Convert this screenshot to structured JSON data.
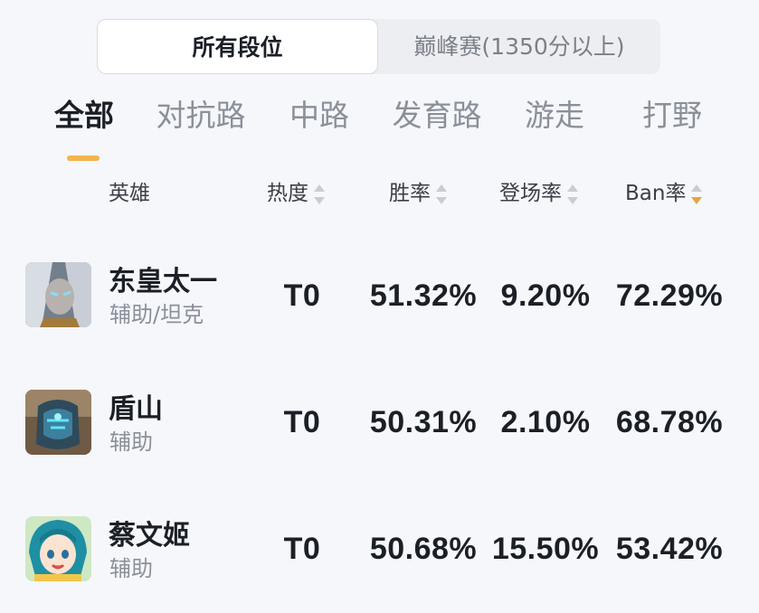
{
  "rank_toggle": {
    "options": [
      {
        "label": "所有段位",
        "active": true
      },
      {
        "label": "巅峰赛(1350分以上)",
        "active": false
      }
    ]
  },
  "role_tabs": {
    "items": [
      {
        "label": "全部",
        "active": true
      },
      {
        "label": "对抗路",
        "active": false
      },
      {
        "label": "中路",
        "active": false
      },
      {
        "label": "发育路",
        "active": false
      },
      {
        "label": "游走",
        "active": false
      },
      {
        "label": "打野",
        "active": false
      }
    ],
    "indicator_color": "#f2b54c"
  },
  "table": {
    "headers": {
      "hero": "英雄",
      "heat": "热度",
      "win_rate": "胜率",
      "pick_rate": "登场率",
      "ban_rate": "Ban率"
    },
    "sort": {
      "column": "ban_rate",
      "direction": "desc",
      "active_color": "#e3a443"
    },
    "rows": [
      {
        "name": "东皇太一",
        "role": "辅助/坦克",
        "heat": "T0",
        "win_rate": "51.32%",
        "pick_rate": "9.20%",
        "ban_rate": "72.29%",
        "avatar_icon": "hero-donghuang-avatar"
      },
      {
        "name": "盾山",
        "role": "辅助",
        "heat": "T0",
        "win_rate": "50.31%",
        "pick_rate": "2.10%",
        "ban_rate": "68.78%",
        "avatar_icon": "hero-dunshan-avatar"
      },
      {
        "name": "蔡文姬",
        "role": "辅助",
        "heat": "T0",
        "win_rate": "50.68%",
        "pick_rate": "15.50%",
        "ban_rate": "53.42%",
        "avatar_icon": "hero-caiwenji-avatar"
      }
    ]
  }
}
